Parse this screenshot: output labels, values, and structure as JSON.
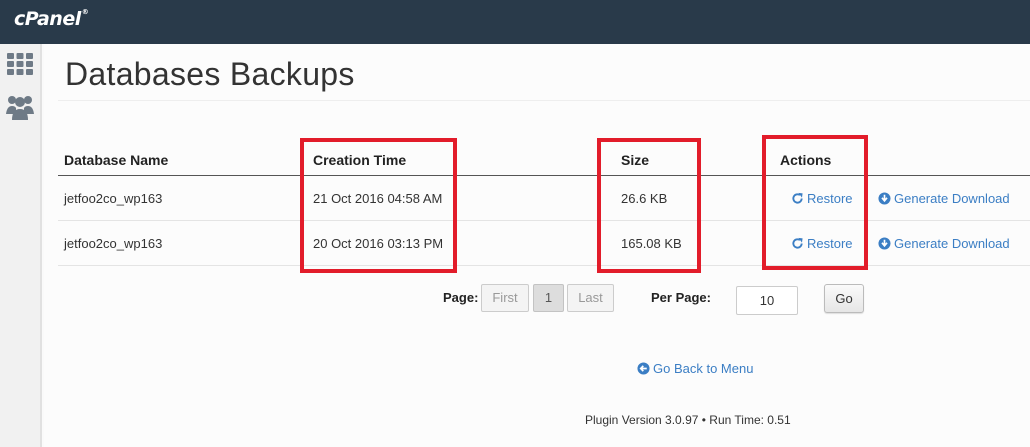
{
  "header": {
    "logo_text": "cPanel",
    "logo_mark": "®"
  },
  "sidebar": {
    "icons": [
      "grid-icon",
      "users-icon"
    ]
  },
  "page": {
    "title": "Databases Backups"
  },
  "table": {
    "columns": {
      "db_name": "Database Name",
      "creation_time": "Creation Time",
      "size": "Size",
      "actions": "Actions"
    },
    "rows": [
      {
        "db_name": "jetfoo2co_wp163",
        "creation_time": "21 Oct 2016 04:58 AM",
        "size": "26.6 KB",
        "restore": "Restore",
        "download": "Generate Download"
      },
      {
        "db_name": "jetfoo2co_wp163",
        "creation_time": "20 Oct 2016 03:13 PM",
        "size": "165.08 KB",
        "restore": "Restore",
        "download": "Generate Download"
      }
    ]
  },
  "pagination": {
    "page_label": "Page:",
    "first": "First",
    "current": "1",
    "last": "Last",
    "per_page_label": "Per Page:",
    "per_page_value": "10",
    "go_label": "Go"
  },
  "back_link": "Go Back to Menu",
  "footer": "Plugin Version 3.0.97 • Run Time: 0.51",
  "colors": {
    "topbar": "#293a4a",
    "link": "#3b7ec4",
    "highlight": "#e21c2a"
  }
}
